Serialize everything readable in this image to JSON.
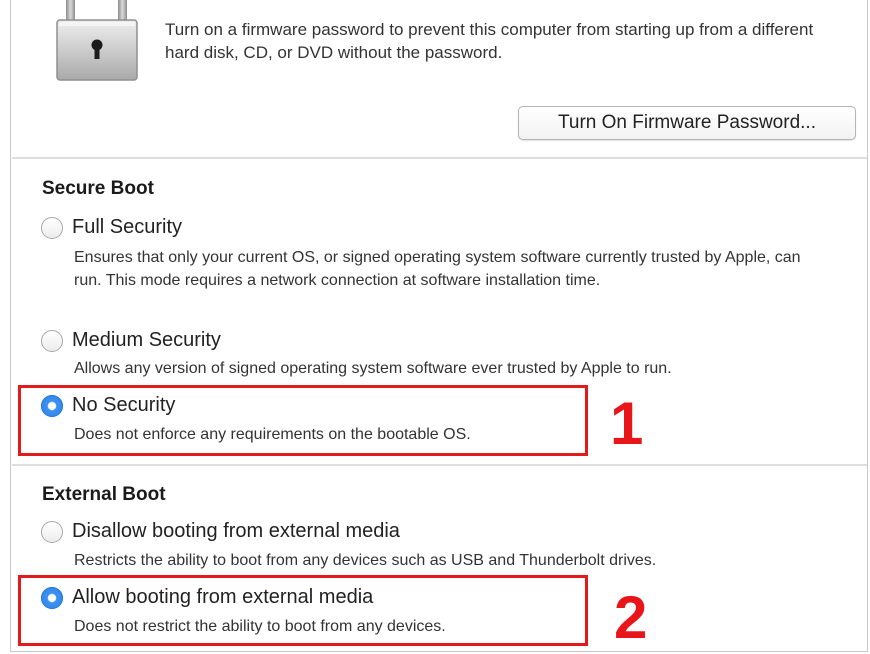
{
  "firmware": {
    "description": "Turn on a firmware password to prevent this computer from starting up from a different hard disk, CD, or DVD without the password.",
    "button_label": "Turn On Firmware Password..."
  },
  "secure_boot": {
    "title": "Secure Boot",
    "options": [
      {
        "label": "Full Security",
        "description": "Ensures that only your current OS, or signed operating system software currently trusted by Apple, can run. This mode requires a network connection at software installation time.",
        "selected": false
      },
      {
        "label": "Medium Security",
        "description": "Allows any version of signed operating system software ever trusted by Apple to run.",
        "selected": false
      },
      {
        "label": "No Security",
        "description": "Does not enforce any requirements on the bootable OS.",
        "selected": true
      }
    ]
  },
  "external_boot": {
    "title": "External Boot",
    "options": [
      {
        "label": "Disallow booting from external media",
        "description": "Restricts the ability to boot from any devices such as USB and Thunderbolt drives.",
        "selected": false
      },
      {
        "label": "Allow booting from external media",
        "description": "Does not restrict the ability to boot from any devices.",
        "selected": true
      }
    ]
  },
  "annotations": {
    "marker_1": "1",
    "marker_2": "2",
    "highlight_color": "#e31b1b"
  },
  "colors": {
    "radio_selected": "#2c7fe6"
  },
  "icons": {
    "lock": "padlock-icon"
  }
}
